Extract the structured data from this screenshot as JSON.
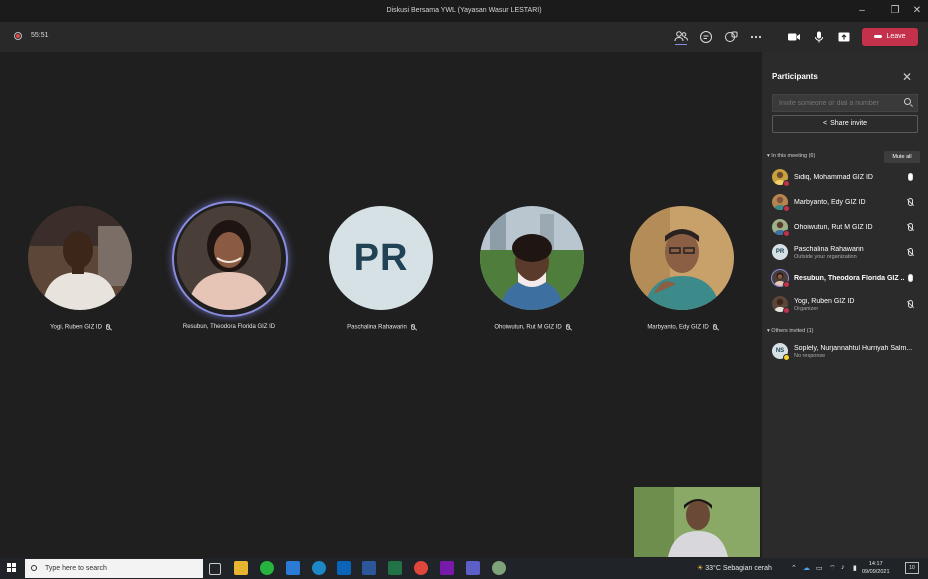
{
  "window": {
    "title": "Diskusi Bersama YWL (Yayasan Wasur LESTARI)"
  },
  "toolbar": {
    "timer": "55:51",
    "leave_label": "Leave"
  },
  "stage": {
    "tiles": [
      {
        "name": "Yogi, Ruben GIZ ID"
      },
      {
        "name": "Resubun, Theodora Florida GIZ ID"
      },
      {
        "name": "Paschalina Rahawarin",
        "initials": "PR"
      },
      {
        "name": "Ohoiwutun, Rut M GIZ ID"
      },
      {
        "name": "Marbyanto, Edy GIZ ID"
      }
    ]
  },
  "panel": {
    "title": "Participants",
    "invite_placeholder": "Invite someone or dial a number",
    "share_label": "Share invite",
    "in_meeting_label": "In this meeting (6)",
    "mute_all_label": "Mute all",
    "others_label": "Others invited (1)",
    "participants": [
      {
        "name": "Sidiq, Mohammad GIZ ID",
        "sub": ""
      },
      {
        "name": "Marbyanto, Edy GIZ ID",
        "sub": ""
      },
      {
        "name": "Ohoiwutun, Rut M GIZ ID",
        "sub": ""
      },
      {
        "name": "Paschalina Rahawarin",
        "sub": "Outside your organization",
        "initials": "PR"
      },
      {
        "name": "Resubun, Theodora Florida GIZ ...",
        "sub": ""
      },
      {
        "name": "Yogi, Ruben GIZ ID",
        "sub": "Organizer"
      }
    ],
    "others": [
      {
        "name": "Soplely, Nurjannahtul Hurriyah Salm...",
        "sub": "No response",
        "initials": "NS"
      }
    ]
  },
  "taskbar": {
    "search_placeholder": "Type here to search",
    "weather": "33°C  Sebagian cerah",
    "time": "14:17",
    "date": "09/09/2021",
    "notif_count": "10"
  }
}
